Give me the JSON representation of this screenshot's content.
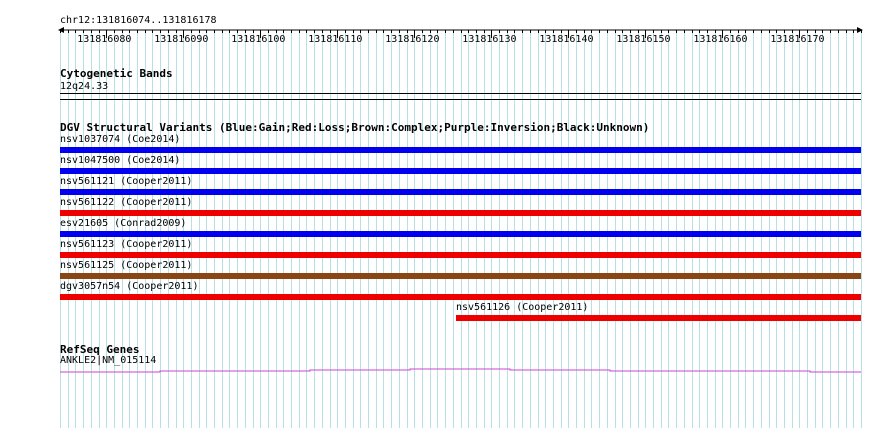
{
  "ruler": {
    "location": "chr12:131816074..131816178",
    "ticks": [
      "131816080",
      "131816090",
      "131816100",
      "131816110",
      "131816120",
      "131816130",
      "131816140",
      "131816150",
      "131816160",
      "131816170"
    ]
  },
  "cytobands": {
    "title": "Cytogenetic Bands",
    "band": "12q24.33"
  },
  "dgv": {
    "title": "DGV Structural Variants (Blue:Gain;Red:Loss;Brown:Complex;Purple:Inversion;Black:Unknown)",
    "variants": [
      {
        "label": "nsv1037074 (Coe2014)",
        "color": "#0000ee"
      },
      {
        "label": "nsv1047500 (Coe2014)",
        "color": "#0000ee"
      },
      {
        "label": "nsv561121 (Cooper2011)",
        "color": "#0000ee"
      },
      {
        "label": "nsv561122 (Cooper2011)",
        "color": "#ee0000"
      },
      {
        "label": "esv21605 (Conrad2009)",
        "color": "#0000ee"
      },
      {
        "label": "nsv561123 (Cooper2011)",
        "color": "#ee0000"
      },
      {
        "label": "nsv561125 (Cooper2011)",
        "color": "#8b4513"
      },
      {
        "label": "dgv3057n54 (Cooper2011)",
        "color": "#ee0000"
      },
      {
        "label": "nsv561126 (Cooper2011)",
        "color": "#ee0000"
      }
    ]
  },
  "refseq": {
    "title": "RefSeq Genes",
    "gene": "ANKLE2|NM_015114",
    "color": "#cc44cc"
  },
  "colors": {
    "grid": "#b8dfe6"
  }
}
